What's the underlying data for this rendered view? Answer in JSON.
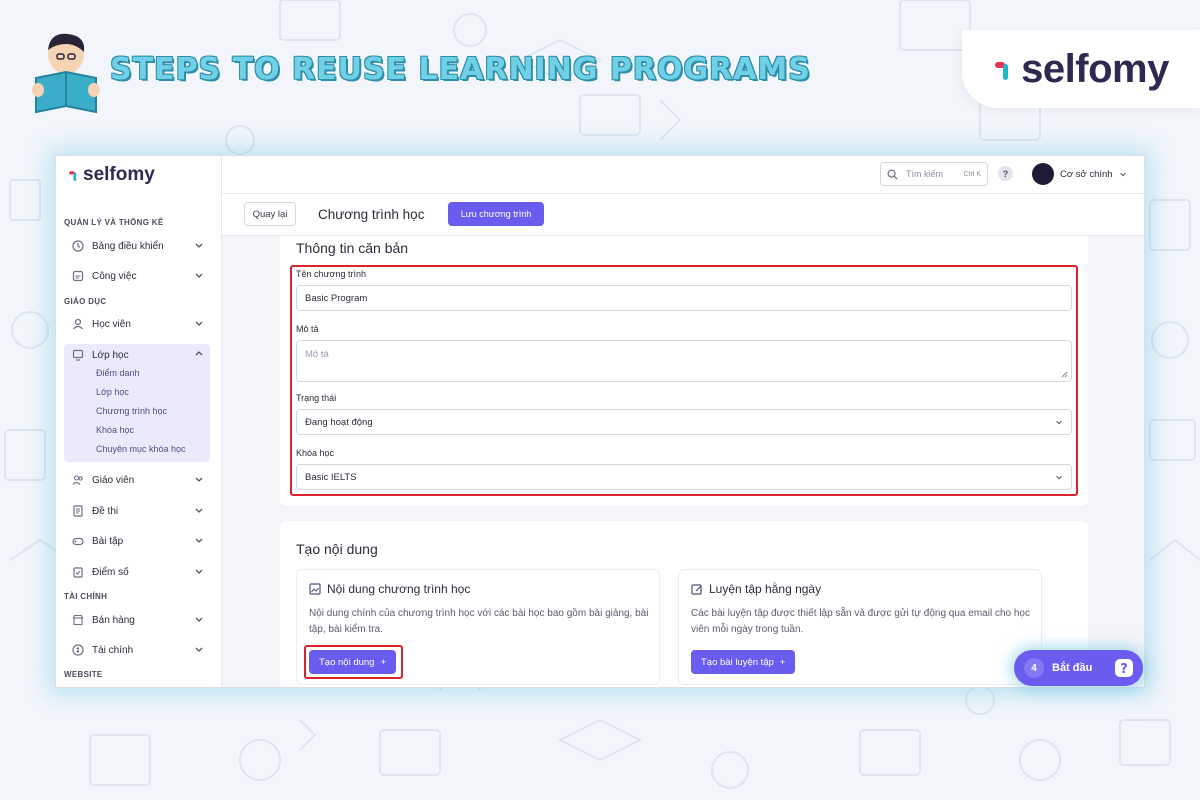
{
  "banner": {
    "title": "STEPS TO REUSE LEARNING PROGRAMS",
    "brand": "selfomy"
  },
  "colors": {
    "accent": "#6b5cf0",
    "highlight": "#d9242f",
    "banner_text": "#6fd0e6",
    "brand_dot_red": "#e8344a",
    "brand_dot_teal": "#1fb6c9"
  },
  "app": {
    "logo": "selfomy",
    "topbar": {
      "search_placeholder": "Tìm kiếm",
      "search_shortcut": "Ctrl K",
      "help": "?",
      "branch": "Cơ sở chính"
    },
    "actionbar": {
      "back": "Quay lại",
      "title": "Chương trình học",
      "save": "Lưu chương trình"
    },
    "sidebar": {
      "sections": {
        "management": "QUẢN LÝ VÀ THỐNG KÊ",
        "education": "GIÁO DỤC",
        "finance": "TÀI CHÍNH",
        "website": "WEBSITE"
      },
      "items": {
        "dashboard": "Bảng điều khiển",
        "tasks": "Công việc",
        "students": "Học viên",
        "classes": "Lớp học",
        "teachers": "Giáo viên",
        "exams": "Đề thi",
        "exercises": "Bài tập",
        "scores": "Điểm số",
        "sales": "Bán hàng",
        "finance": "Tài chính"
      },
      "class_sub": [
        "Điểm danh",
        "Lớp học",
        "Chương trình học",
        "Khóa học",
        "Chuyên mục khóa học"
      ]
    },
    "basic_info": {
      "title": "Thông tin căn bản",
      "name_label": "Tên chương trình",
      "name_value": "Basic Program",
      "desc_label": "Mô tả",
      "desc_placeholder": "Mô tả",
      "status_label": "Trạng thái",
      "status_value": "Đang hoạt động",
      "course_label": "Khóa học",
      "course_value": "Basic IELTS"
    },
    "create_content": {
      "title": "Tạo nội dung",
      "program_card": {
        "title": "Nội dung chương trình học",
        "desc": "Nội dung chính của chương trình học với các bài học bao gồm bài giảng, bài tập, bài kiểm tra.",
        "button": "Tạo nội dung"
      },
      "practice_card": {
        "title": "Luyện tập hằng ngày",
        "desc": "Các bài luyện tập được thiết lập sẵn và được gửi tự động qua email cho học viên mỗi ngày trong tuần.",
        "button": "Tạo bài luyện tập"
      }
    },
    "start": {
      "count": "4",
      "label": "Bắt đầu"
    }
  }
}
